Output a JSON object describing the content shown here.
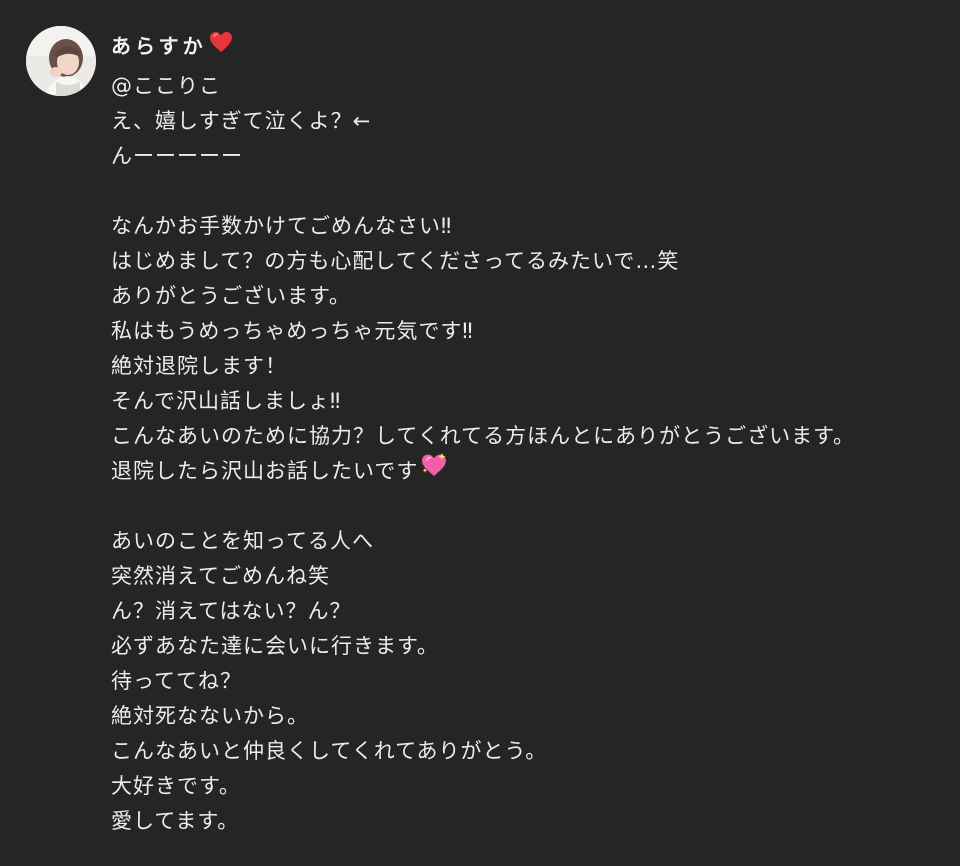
{
  "post": {
    "author_name": "あらすか",
    "author_name_icon": "red-heart-icon",
    "mention": "@ここりこ",
    "lines": [
      "え、嬉しすぎて泣くよ？←",
      "んーーーーー",
      "",
      "なんかお手数かけてごめんなさい‼",
      "はじめまして？の方も心配してくださってるみたいで…笑",
      "ありがとうございます。",
      "私はもうめっちゃめっちゃ元気です‼",
      "絶対退院します！",
      "そんで沢山話しましょ‼",
      "こんなあいのために協力？してくれてる方ほんとにありがとうございます。",
      "退院したら沢山お話したいです",
      "",
      "あいのことを知ってる人へ",
      "突然消えてごめんね笑",
      "ん？消えてはない？ん？",
      "必ずあなた達に会いに行きます。",
      "待っててね？",
      "絶対死なないから。",
      "こんなあいと仲良くしてくれてありがとう。",
      "大好きです。",
      "愛してます。"
    ],
    "sparkle_line_icon": "sparkling-heart-icon"
  },
  "colors": {
    "background": "#252525",
    "text": "#ececec",
    "heart": "#e8353b",
    "sparkle_heart": "#f25fa8"
  }
}
